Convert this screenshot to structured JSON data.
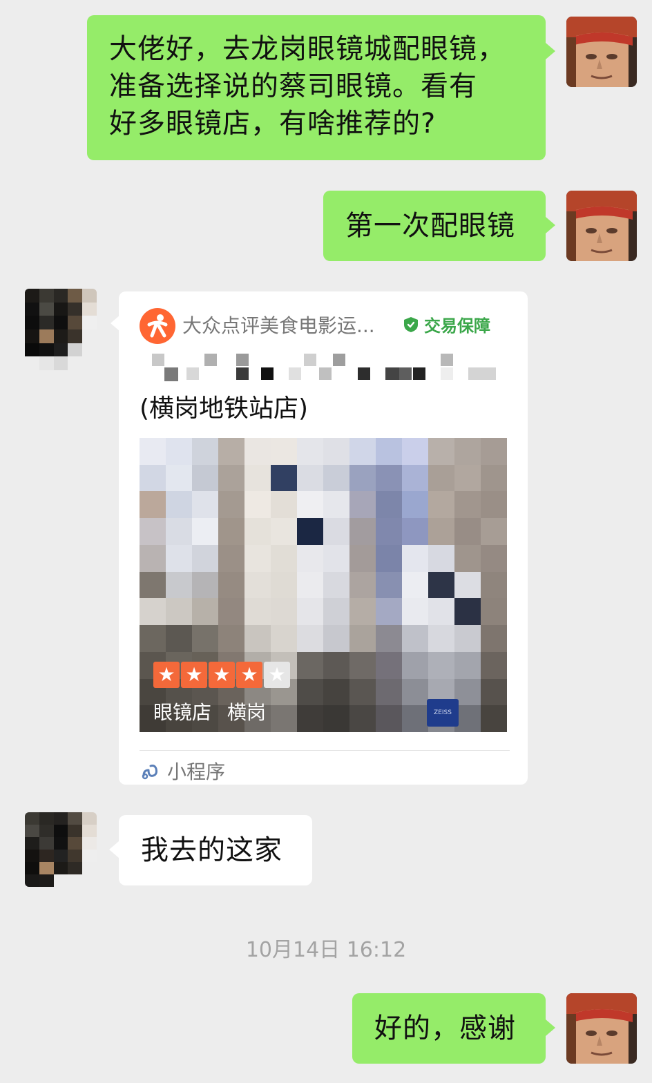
{
  "messages": {
    "msg1": {
      "sender": "me",
      "text": "大佬好，去龙岗眼镜城配眼镜，\n准备选择说的蔡司眼镜。看有\n好多眼镜店，有啥推荐的?"
    },
    "msg2": {
      "sender": "me",
      "text": "第一次配眼镜"
    },
    "msg3": {
      "sender": "other",
      "card": {
        "source": "大众点评美食电影运...",
        "guarantee": "交易保障",
        "subtitle": "(横岗地铁站店)",
        "rating_stars": 4,
        "rating_max": 5,
        "tags": [
          "眼镜店",
          "横岗"
        ],
        "brand_badge": "ZEISS",
        "mini_program_label": "小程序"
      }
    },
    "msg4": {
      "sender": "other",
      "text": "我去的这家"
    },
    "timestamp": "10月14日 16:12",
    "msg5": {
      "sender": "me",
      "text": "好的，感谢"
    }
  },
  "colors": {
    "my_bubble": "#95ec69",
    "other_bubble": "#ffffff",
    "background": "#ededed",
    "star": "#f4693a",
    "guarantee": "#3ba74a"
  },
  "icons": {
    "card_logo": "dianping-logo-icon",
    "guarantee": "shield-icon",
    "mini_program": "mini-program-link-icon"
  }
}
